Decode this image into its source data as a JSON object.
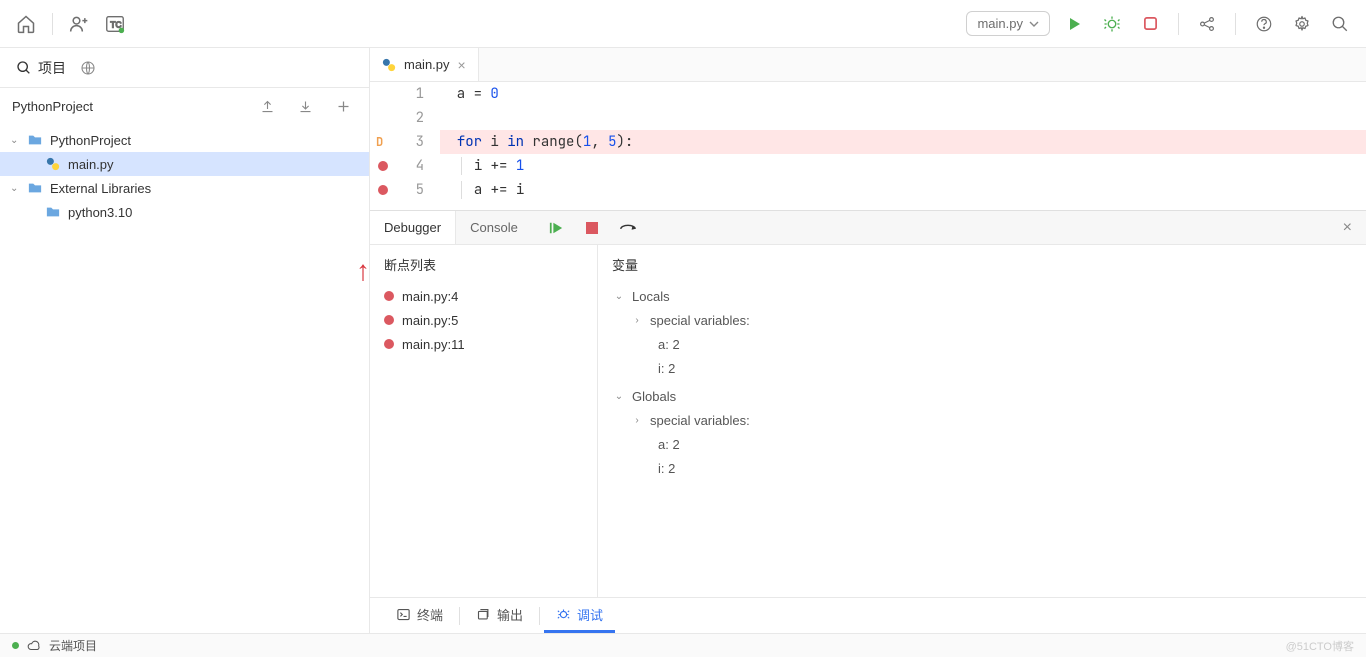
{
  "toolbar": {
    "run_config": "main.py"
  },
  "sidebar": {
    "tab_project": "项目",
    "project_name": "PythonProject",
    "tree": [
      {
        "label": "PythonProject",
        "type": "folder",
        "depth": 0,
        "expanded": true
      },
      {
        "label": "main.py",
        "type": "py",
        "depth": 1,
        "selected": true
      },
      {
        "label": "External Libraries",
        "type": "folder",
        "depth": 0,
        "expanded": true
      },
      {
        "label": "python3.10",
        "type": "folder",
        "depth": 1
      }
    ]
  },
  "editor": {
    "tab_name": "main.py",
    "lines": [
      {
        "n": 1,
        "code_html": "a <span class='op'>=</span> <span class='num'>0</span>"
      },
      {
        "n": 2,
        "code_html": ""
      },
      {
        "n": 3,
        "exec": true,
        "highlight": true,
        "code_html": "<span class='kw'>for</span> i <span class='kw'>in</span> range(<span class='num'>1</span>, <span class='num'>5</span>):"
      },
      {
        "n": 4,
        "bp": true,
        "indent": true,
        "code_html": "i <span class='op'>+=</span> <span class='num'>1</span>"
      },
      {
        "n": 5,
        "bp": true,
        "indent": true,
        "code_html": "a <span class='op'>+=</span> i"
      }
    ]
  },
  "debug": {
    "tab_debugger": "Debugger",
    "tab_console": "Console",
    "bp_title": "断点列表",
    "breakpoints": [
      "main.py:4",
      "main.py:5",
      "main.py:11"
    ],
    "vars_title": "变量",
    "scopes": [
      {
        "name": "Locals",
        "vars": [
          {
            "k": "a",
            "v": "2"
          },
          {
            "k": "i",
            "v": "2"
          }
        ],
        "special": "special variables:"
      },
      {
        "name": "Globals",
        "vars": [
          {
            "k": "a",
            "v": "2"
          },
          {
            "k": "i",
            "v": "2"
          }
        ],
        "special": "special variables:"
      }
    ]
  },
  "bottom": {
    "terminal": "终端",
    "output": "输出",
    "debug": "调试"
  },
  "status": {
    "cloud": "云端项目",
    "watermark": "@51CTO博客"
  }
}
